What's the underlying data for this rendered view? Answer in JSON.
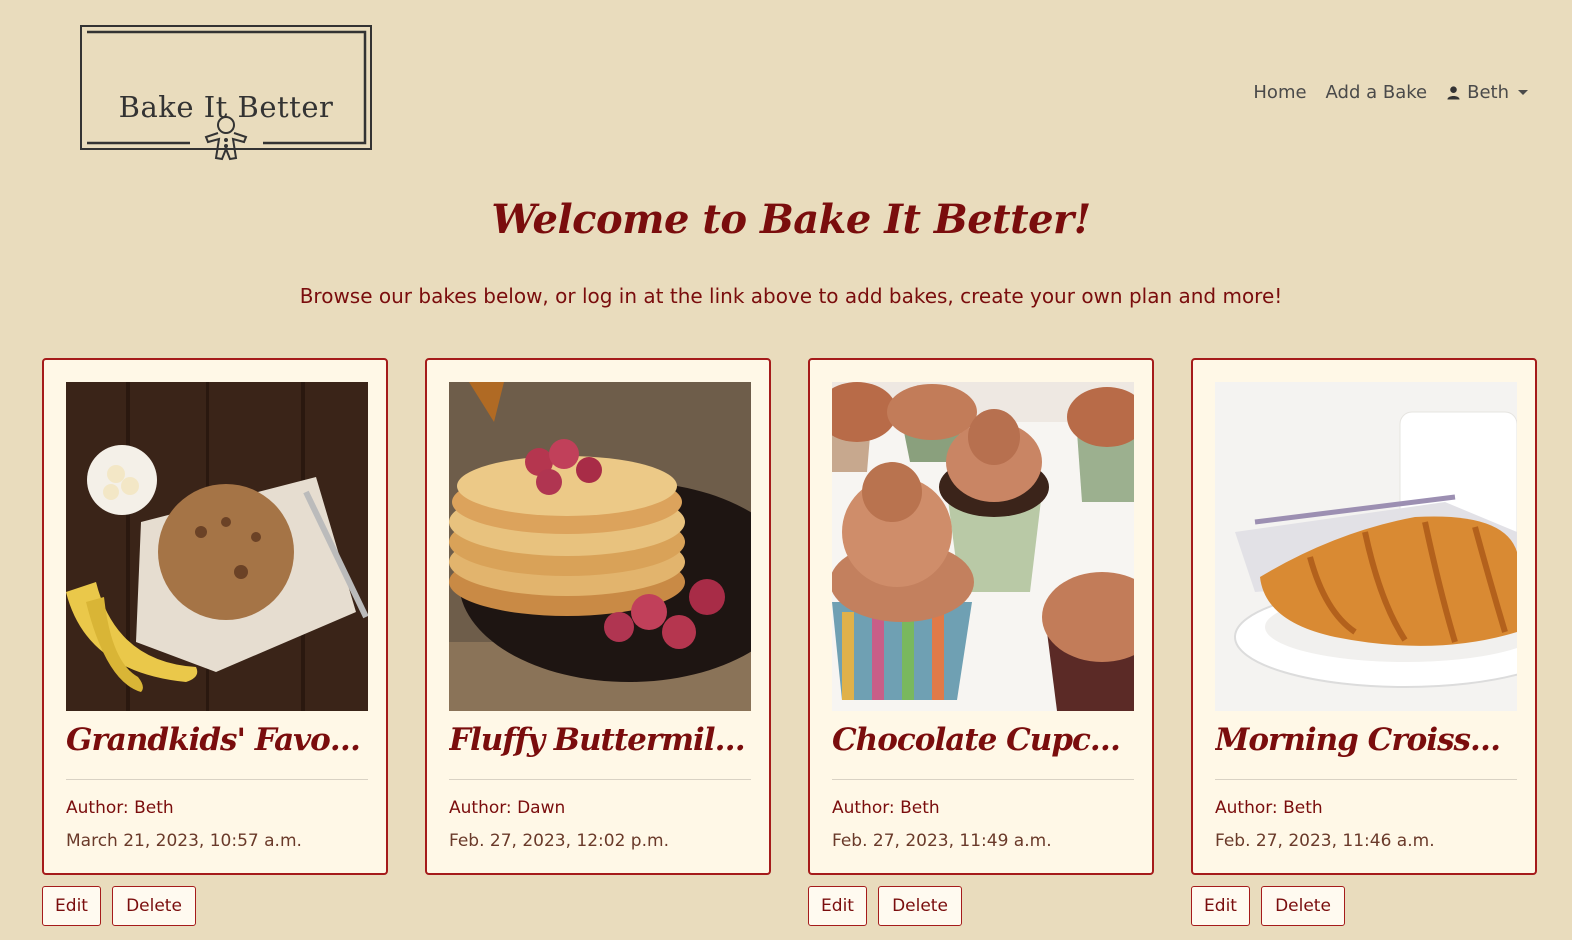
{
  "logo": {
    "text": "Bake It Better"
  },
  "nav": {
    "home": "Home",
    "add_bake": "Add a Bake",
    "user": "Beth"
  },
  "header": {
    "welcome": "Welcome to Bake It Better!",
    "intro": "Browse our bakes below, or log in at the link above to add bakes, create your own plan and more!"
  },
  "cards": [
    {
      "title": "Grandkids' Favourite Cookies",
      "author": "Author: Beth",
      "date": "March 21, 2023, 10:57 a.m.",
      "image": "cookie-banana-photo",
      "edit_label": "Edit",
      "delete_label": "Delete"
    },
    {
      "title": "Fluffy Buttermilk Pancakes",
      "author": "Author: Dawn",
      "date": "Feb. 27, 2023, 12:02 p.m.",
      "image": "pancakes-raspberries-photo"
    },
    {
      "title": "Chocolate Cupcakes",
      "author": "Author: Beth",
      "date": "Feb. 27, 2023, 11:49 a.m.",
      "image": "chocolate-cupcakes-photo",
      "edit_label": "Edit",
      "delete_label": "Delete"
    },
    {
      "title": "Morning Croissant",
      "author": "Author: Beth",
      "date": "Feb. 27, 2023, 11:46 a.m.",
      "image": "croissant-plate-photo",
      "edit_label": "Edit",
      "delete_label": "Delete"
    }
  ],
  "colors": {
    "background": "#e9dcbd",
    "card_background": "#fff8e7",
    "accent": "#7a0d0d",
    "border": "#a51b1b"
  }
}
